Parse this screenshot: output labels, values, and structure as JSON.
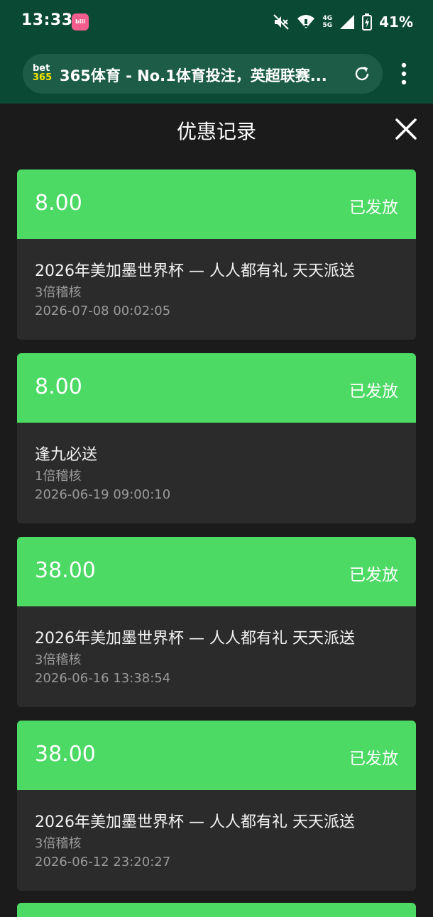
{
  "status_bar": {
    "time": "13:33",
    "app_icon": "bilibili",
    "net_top": "4G",
    "net_bottom": "5G",
    "battery": "41%",
    "icons": [
      "mute-icon",
      "wifi-icon",
      "signal-icon",
      "battery-icon"
    ]
  },
  "browser": {
    "logo_top": "bet",
    "logo_bottom": "365",
    "url_title": "365体育 - No.1体育投注，英超联赛...",
    "icons": [
      "reload-icon",
      "more-vert-icon"
    ]
  },
  "page": {
    "title": "优惠记录"
  },
  "records": [
    {
      "amount": "8.00",
      "status": "已发放",
      "title": "2026年美加墨世界杯 — 人人都有礼 天天派送",
      "multiplier": "3倍稽核",
      "time": "2026-07-08 00:02:05"
    },
    {
      "amount": "8.00",
      "status": "已发放",
      "title": "逢九必送",
      "multiplier": "1倍稽核",
      "time": "2026-06-19 09:00:10"
    },
    {
      "amount": "38.00",
      "status": "已发放",
      "title": "2026年美加墨世界杯 — 人人都有礼 天天派送",
      "multiplier": "3倍稽核",
      "time": "2026-06-16 13:38:54"
    },
    {
      "amount": "38.00",
      "status": "已发放",
      "title": "2026年美加墨世界杯 — 人人都有礼 天天派送",
      "multiplier": "3倍稽核",
      "time": "2026-06-12 23:20:27"
    }
  ],
  "colors": {
    "chrome": "#0a4a35",
    "accent_green": "#4cd964",
    "background": "#1b1b1b",
    "card_body": "#2b2b2b"
  }
}
